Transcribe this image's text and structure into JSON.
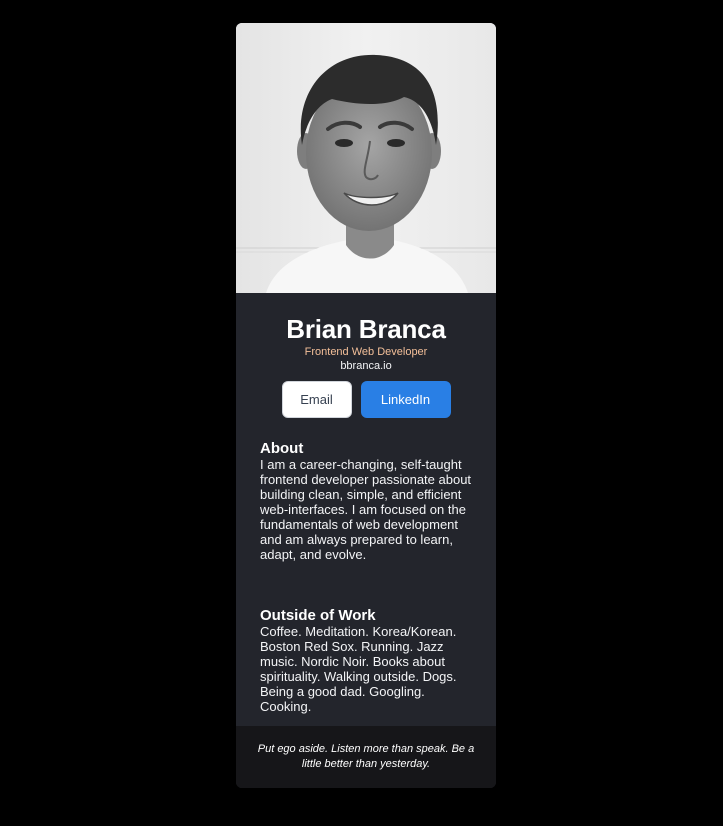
{
  "profile": {
    "name": "Brian Branca",
    "role": "Frontend Web Developer",
    "website": "bbranca.io"
  },
  "buttons": {
    "email_label": "Email",
    "linkedin_label": "LinkedIn"
  },
  "about": {
    "heading": "About",
    "text": "I am a career-changing, self-taught frontend developer passionate about building clean, simple, and efficient web-interfaces. I am focused on the fundamentals of web development and am always prepared to learn, adapt, and evolve."
  },
  "outside_work": {
    "heading": "Outside of Work",
    "text": "Coffee. Meditation. Korea/Korean. Boston Red Sox. Running. Jazz music. Nordic Noir. Books about spirituality. Walking outside. Dogs. Being a good dad. Googling. Cooking."
  },
  "footer": {
    "quote": "Put ego aside. Listen more than speak. Be a little better than yesterday."
  },
  "colors": {
    "page_background": "#000000",
    "card_background": "#23252c",
    "footer_background": "#161619",
    "role_accent": "#f3bf99",
    "linkedin_blue": "#297fe5",
    "email_button_background": "#ffffff"
  }
}
